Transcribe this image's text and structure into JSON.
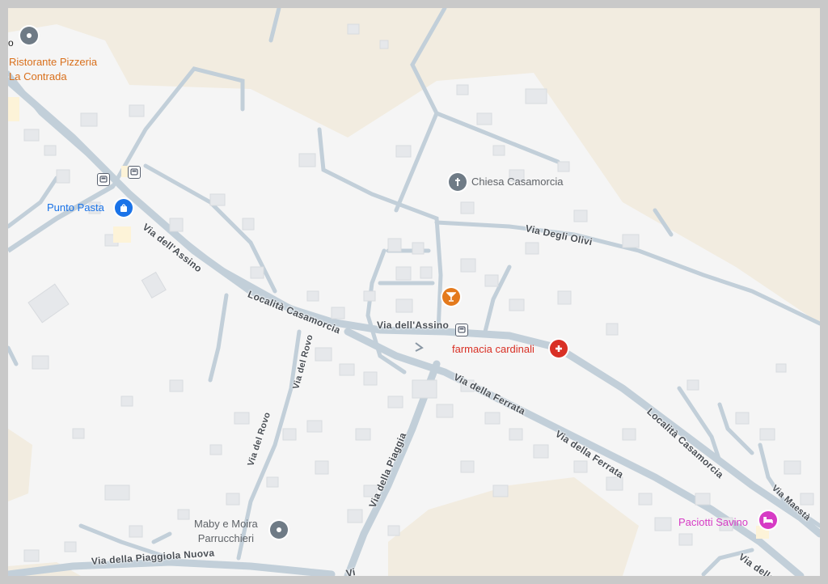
{
  "colors": {
    "land": "#f5f5f5",
    "terrain": "#f2ece0",
    "road": "#c2cfd9",
    "building": "#e6e8eb",
    "food_accent": "#e47a1d",
    "shopping_accent": "#1a73e8",
    "health_accent": "#d93025",
    "hotel_accent": "#d63bc5",
    "generic_poi": "#6f7b86"
  },
  "places": {
    "ristorante": "Ristorante Pizzeria\nLa Contrada",
    "punto_pasta": "Punto Pasta",
    "chiesa": "Chiesa Casamorcia",
    "farmacia": "farmacia cardinali",
    "maby": "Maby e Moira\nParrucchieri",
    "paciotti": "Paciotti Savino",
    "top_left_fragment": "o"
  },
  "streets": {
    "assino_west": "Via dell'Assino",
    "localita_west": "Località Casamorcia",
    "assino_center": "Via dell'Assino",
    "degli_olivi": "Via Degli Olivi",
    "ferrata_1": "Via della Ferrata",
    "ferrata_2": "Via della Ferrata",
    "localita_east": "Località Casamorcia",
    "maesta": "Via Maestà",
    "rovo_1": "Via del Rovo",
    "rovo_2": "Via del Rovo",
    "piaggia": "Via della Piaggia",
    "piaggiola": "Via della Piaggiola Nuova",
    "ferrata_edge": "Via della",
    "bottom_fragment": "Vi"
  },
  "icons": {
    "ristorante": "restaurant-pin-icon",
    "punto_pasta": "shopping-bag-icon",
    "chiesa": "church-cross-icon",
    "bar": "cocktail-icon",
    "farmacia": "pharmacy-icon",
    "maby": "generic-place-icon",
    "paciotti": "hotel-bed-icon",
    "bus": "bus-stop-icon"
  }
}
